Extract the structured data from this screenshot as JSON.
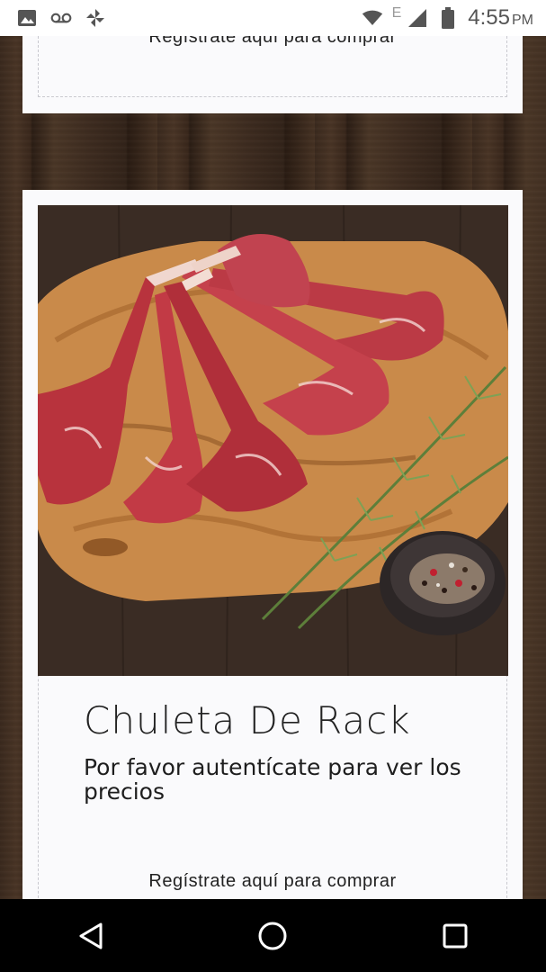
{
  "status_bar": {
    "time": "4:55",
    "ampm": "PM",
    "network_type": "E",
    "icons": [
      "image-icon",
      "voicemail-icon",
      "pinwheel-icon",
      "wifi-icon",
      "signal-icon",
      "battery-icon"
    ]
  },
  "cards": {
    "previous": {
      "register_label": "Regístrate aquí para comprar"
    },
    "current": {
      "image_alt": "lamb-chops-photo",
      "title": "Chuleta De Rack",
      "price_note": "Por favor autentícate para ver los precios",
      "register_label": "Regístrate aquí para comprar"
    }
  },
  "nav_bar": {
    "icons": [
      "back-icon",
      "home-icon",
      "recents-icon"
    ]
  }
}
